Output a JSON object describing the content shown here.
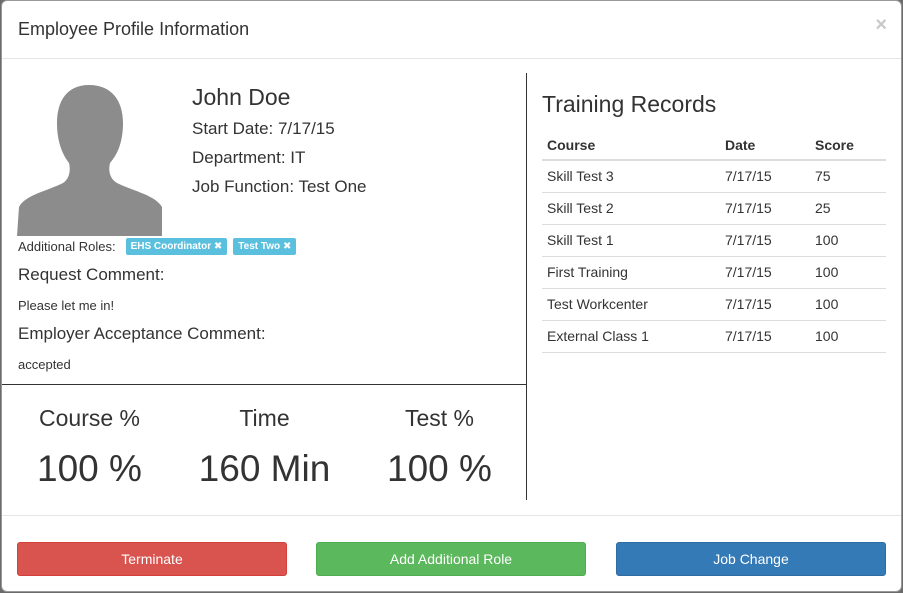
{
  "modal": {
    "title": "Employee Profile Information",
    "close_glyph": "×"
  },
  "profile": {
    "name": "John Doe",
    "start_date": "Start Date: 7/17/15",
    "department": "Department: IT",
    "job_function": "Job Function: Test One",
    "avatar_icon": "person-silhouette-icon"
  },
  "roles": {
    "label": "Additional Roles:",
    "badges": [
      {
        "text": "EHS Coordinator",
        "remove_glyph": "✖"
      },
      {
        "text": "Test Two",
        "remove_glyph": "✖"
      }
    ],
    "badge_color": "#5bc0de"
  },
  "comments": {
    "request_label": "Request Comment:",
    "request_text": "Please let me in!",
    "acceptance_label": "Employer Acceptance Comment:",
    "acceptance_text": "accepted"
  },
  "stats": [
    {
      "label": "Course %",
      "value": "100 %"
    },
    {
      "label": "Time",
      "value": "160 Min"
    },
    {
      "label": "Test %",
      "value": "100 %"
    }
  ],
  "training": {
    "title": "Training Records",
    "columns": [
      "Course",
      "Date",
      "Score"
    ],
    "rows": [
      [
        "Skill Test 3",
        "7/17/15",
        "75"
      ],
      [
        "Skill Test 2",
        "7/17/15",
        "25"
      ],
      [
        "Skill Test 1",
        "7/17/15",
        "100"
      ],
      [
        "First Training",
        "7/17/15",
        "100"
      ],
      [
        "Test Workcenter",
        "7/17/15",
        "100"
      ],
      [
        "External Class 1",
        "7/17/15",
        "100"
      ]
    ]
  },
  "footer": {
    "terminate_label": "Terminate",
    "add_role_label": "Add Additional Role",
    "job_change_label": "Job Change",
    "colors": {
      "danger": "#d9534f",
      "success": "#5cb85c",
      "primary": "#337ab7"
    }
  }
}
